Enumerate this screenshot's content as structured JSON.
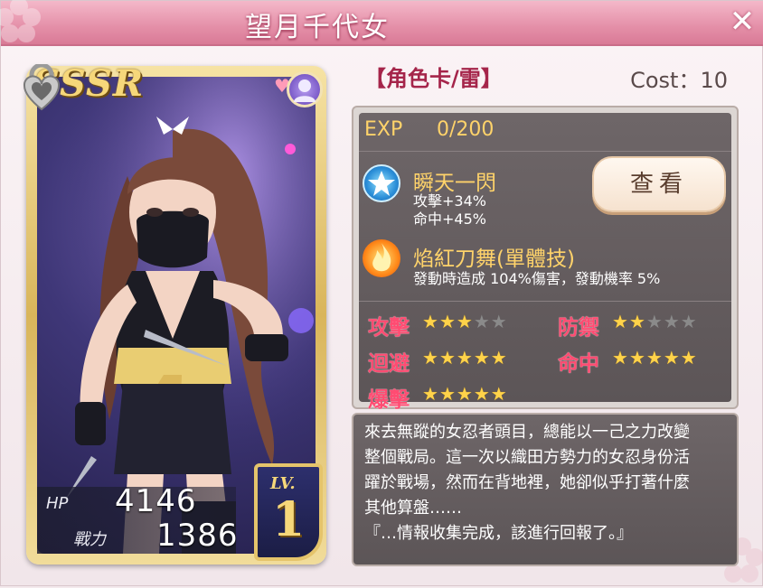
{
  "window": {
    "title": "望月千代女",
    "close_label": "✕"
  },
  "card": {
    "rarity": "SSSR",
    "hp_label": "HP",
    "hp_value": "4146",
    "power_label": "戰力",
    "power_value": "1386",
    "level_label": "LV.",
    "level_value": "1"
  },
  "header": {
    "card_type": "【角色卡/雷】",
    "cost": "Cost：10"
  },
  "exp": {
    "label": "EXP",
    "value": "0/200"
  },
  "skills": [
    {
      "name": "瞬天一閃",
      "icon": "star-skill-icon",
      "desc": [
        "攻擊+34%",
        "命中+45%"
      ]
    },
    {
      "name": "焰紅刀舞(單體技)",
      "icon": "flame-skill-icon",
      "desc": [
        "發動時造成 104%傷害，發動機率 5%"
      ]
    }
  ],
  "view_button": "查看",
  "attributes": [
    {
      "label": "攻擊",
      "stars": 3
    },
    {
      "label": "防禦",
      "stars": 2
    },
    {
      "label": "迴避",
      "stars": 5
    },
    {
      "label": "命中",
      "stars": 5
    },
    {
      "label": "爆擊",
      "stars": 5
    }
  ],
  "max_stars": 5,
  "description": "來去無蹤的女忍者頭目，總能以一己之力改變\n整個戰局。這一次以織田方勢力的女忍身份活\n躍於戰場，然而在背地裡，她卻似乎打著什麼\n其他算盤……\n『…情報收集完成，該進行回報了。』",
  "colors": {
    "title_bar": "#e48fa8",
    "accent": "#ffd36a",
    "attr_label": "#ff4c72"
  }
}
